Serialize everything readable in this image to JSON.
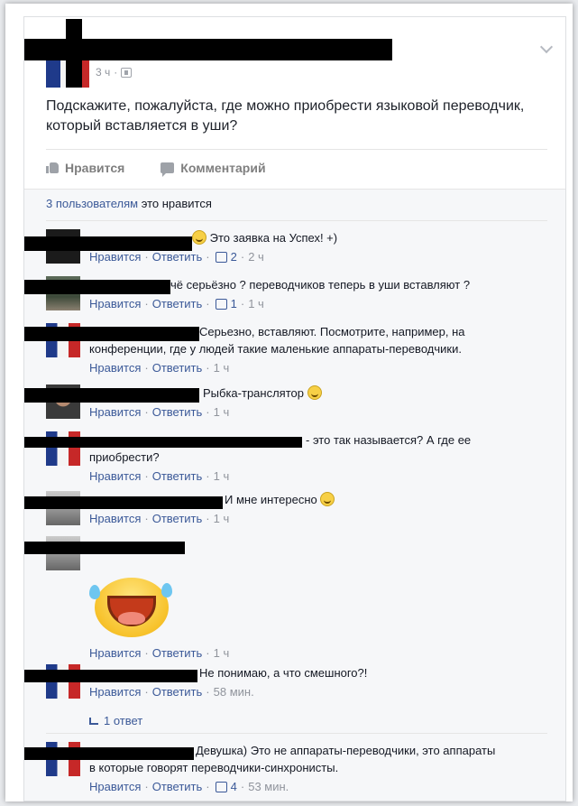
{
  "post": {
    "time": "3 ч",
    "text": "Подскажите, пожалуйста, где можно приобрести языковой переводчик, который вставляется в уши?",
    "actions": {
      "like": "Нравится",
      "comment": "Комментарий"
    }
  },
  "likes_summary": {
    "count_link": "3 пользователям",
    "suffix": "это нравится"
  },
  "comment_actions": {
    "like": "Нравится",
    "reply": "Ответить",
    "dot": "·"
  },
  "comments": [
    {
      "text": "Это заявка на Успех! +)",
      "likes": "2",
      "time": "2 ч"
    },
    {
      "text": "чё серьёзно ? переводчиков теперь в уши вставляют ?",
      "likes": "1",
      "time": "1 ч"
    },
    {
      "text": "Серьезно, вставляют. Посмотрите, например, на",
      "text2": "конференции, где у людей такие маленькие аппараты-переводчики.",
      "time": "1 ч"
    },
    {
      "text": "Рыбка-транслятор",
      "time": "1 ч"
    },
    {
      "text": "- это так называется? А где ее",
      "text2": "приобрести?",
      "time": "1 ч"
    },
    {
      "text": "И мне интересно",
      "time": "1 ч"
    },
    {
      "text": "",
      "time": "1 ч"
    },
    {
      "text": "Не понимаю, а что смешного?!",
      "time": "58 мин."
    },
    {
      "text": "Девушка) Это не аппараты-переводчики, это аппараты",
      "text2": "в которые говорят переводчики-синхронисты.",
      "likes": "4",
      "time": "53 мин."
    }
  ],
  "replies_link": "1 ответ",
  "colors": {
    "link": "#3b5998",
    "meta": "#90949c",
    "redaction": "#000000"
  }
}
